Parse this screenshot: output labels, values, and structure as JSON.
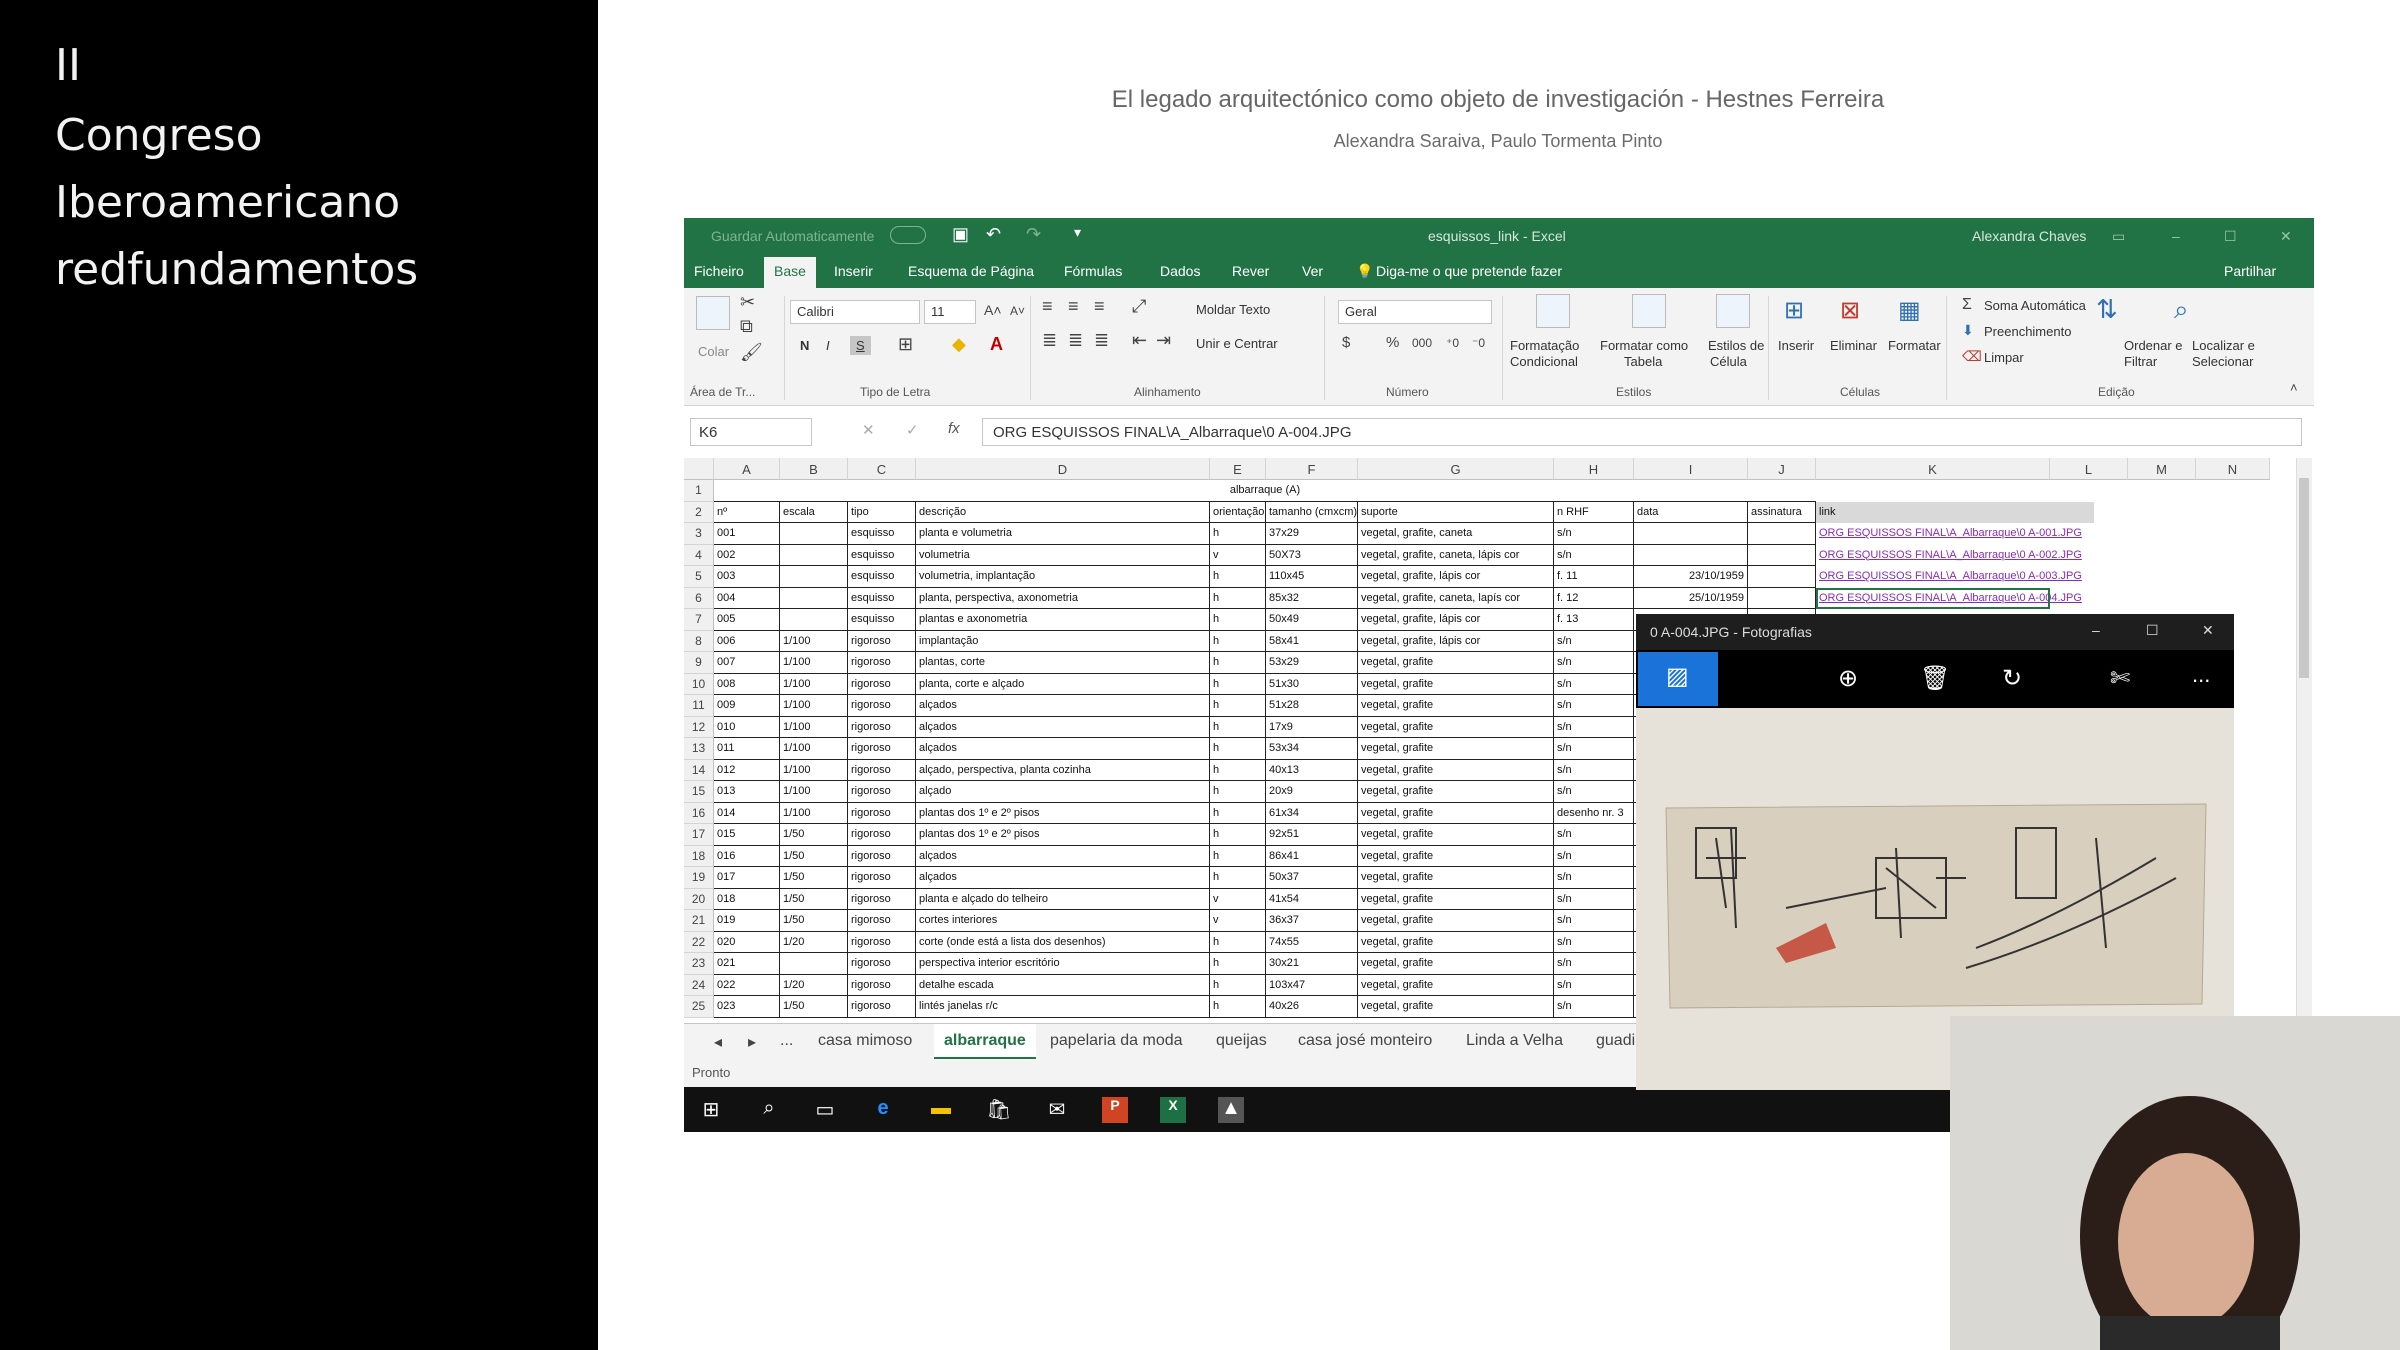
{
  "side": {
    "lines": [
      "II",
      "Congreso",
      "Iberoamericano",
      "redfundamentos"
    ]
  },
  "slide": {
    "title": "El legado arquitectónico como objeto de investigación - Hestnes Ferreira",
    "subtitle": "Alexandra Saraiva, Paulo Tormenta Pinto"
  },
  "excel": {
    "autosave_label": "Guardar Automaticamente",
    "window_title": "esquissos_link - Excel",
    "user": "Alexandra Chaves",
    "menu": [
      "Ficheiro",
      "Base",
      "Inserir",
      "Esquema de Página",
      "Fórmulas",
      "Dados",
      "Rever",
      "Ver"
    ],
    "active_menu": "Base",
    "tell_me": "Diga-me o que pretende fazer",
    "share": "Partilhar",
    "ribbon": {
      "paste": "Colar",
      "font_name": "Calibri",
      "font_size": "11",
      "bold": "N",
      "italic": "I",
      "underline": "S",
      "wrap_text": "Moldar Texto",
      "merge_center": "Unir e Centrar",
      "number_format": "Geral",
      "cond_format": [
        "Formatação",
        "Condicional"
      ],
      "format_table": [
        "Formatar como",
        "Tabela"
      ],
      "cell_styles": [
        "Estilos de",
        "Célula"
      ],
      "insert": "Inserir",
      "delete": "Eliminar",
      "format": "Formatar",
      "autosum": "Soma Automática",
      "fill": "Preenchimento",
      "clear": "Limpar",
      "sort_filter": [
        "Ordenar e",
        "Filtrar"
      ],
      "find_select": [
        "Localizar e",
        "Selecionar"
      ],
      "groups": [
        "Área de Tr...",
        "Tipo de Letra",
        "Alinhamento",
        "Número",
        "Estilos",
        "Células",
        "Edição"
      ]
    },
    "name_box": "K6",
    "formula": "ORG ESQUISSOS FINAL\\A_Albarraque\\0 A-004.JPG",
    "columns": [
      "A",
      "B",
      "C",
      "D",
      "E",
      "F",
      "G",
      "H",
      "I",
      "J",
      "K",
      "L",
      "M",
      "N"
    ],
    "sheet_title": "albarraque (A)",
    "headers": [
      "nº",
      "escala",
      "tipo",
      "descrição",
      "orientação",
      "tamanho (cmxcm)",
      "suporte",
      "n RHF",
      "data",
      "assinatura",
      "link"
    ],
    "rows": [
      [
        "001",
        "",
        "esquisso",
        "planta e volumetria",
        "h",
        "37x29",
        "vegetal, grafite, caneta",
        "s/n",
        "",
        "",
        "ORG ESQUISSOS FINAL\\A_Albarraque\\0 A-001.JPG"
      ],
      [
        "002",
        "",
        "esquisso",
        "volumetria",
        "v",
        "50X73",
        "vegetal, grafite, caneta, lápis cor",
        "s/n",
        "",
        "",
        "ORG ESQUISSOS FINAL\\A_Albarraque\\0 A-002.JPG"
      ],
      [
        "003",
        "",
        "esquisso",
        "volumetria, implantação",
        "h",
        "110x45",
        "vegetal, grafite, lápis cor",
        "f. 11",
        "23/10/1959",
        "",
        "ORG ESQUISSOS FINAL\\A_Albarraque\\0 A-003.JPG"
      ],
      [
        "004",
        "",
        "esquisso",
        "planta, perspectiva, axonometria",
        "h",
        "85x32",
        "vegetal, grafite, caneta, lapís cor",
        "f. 12",
        "25/10/1959",
        "",
        "ORG ESQUISSOS FINAL\\A_Albarraque\\0 A-004.JPG"
      ],
      [
        "005",
        "",
        "esquisso",
        "plantas e axonometria",
        "h",
        "50x49",
        "vegetal, grafite, lápis cor",
        "f. 13",
        "",
        "",
        ""
      ],
      [
        "006",
        "1/100",
        "rigoroso",
        "implantação",
        "h",
        "58x41",
        "vegetal, grafite, lápis cor",
        "s/n",
        "",
        "",
        ""
      ],
      [
        "007",
        "1/100",
        "rigoroso",
        "plantas, corte",
        "h",
        "53x29",
        "vegetal, grafite",
        "s/n",
        "",
        "",
        ""
      ],
      [
        "008",
        "1/100",
        "rigoroso",
        "planta, corte e alçado",
        "h",
        "51x30",
        "vegetal, grafite",
        "s/n",
        "",
        "",
        ""
      ],
      [
        "009",
        "1/100",
        "rigoroso",
        "alçados",
        "h",
        "51x28",
        "vegetal, grafite",
        "s/n",
        "",
        "",
        ""
      ],
      [
        "010",
        "1/100",
        "rigoroso",
        "alçados",
        "h",
        "17x9",
        "vegetal, grafite",
        "s/n",
        "",
        "",
        ""
      ],
      [
        "011",
        "1/100",
        "rigoroso",
        "alçados",
        "h",
        "53x34",
        "vegetal, grafite",
        "s/n",
        "",
        "",
        ""
      ],
      [
        "012",
        "1/100",
        "rigoroso",
        "alçado, perspectiva, planta cozinha",
        "h",
        "40x13",
        "vegetal, grafite",
        "s/n",
        "",
        "",
        ""
      ],
      [
        "013",
        "1/100",
        "rigoroso",
        "alçado",
        "h",
        "20x9",
        "vegetal, grafite",
        "s/n",
        "",
        "",
        ""
      ],
      [
        "014",
        "1/100",
        "rigoroso",
        "plantas dos 1º e 2º pisos",
        "h",
        "61x34",
        "vegetal, grafite",
        "desenho nr. 3",
        "",
        "",
        ""
      ],
      [
        "015",
        "1/50",
        "rigoroso",
        "plantas dos 1º e 2º pisos",
        "h",
        "92x51",
        "vegetal, grafite",
        "s/n",
        "",
        "",
        ""
      ],
      [
        "016",
        "1/50",
        "rigoroso",
        "alçados",
        "h",
        "86x41",
        "vegetal, grafite",
        "s/n",
        "",
        "",
        ""
      ],
      [
        "017",
        "1/50",
        "rigoroso",
        "alçados",
        "h",
        "50x37",
        "vegetal, grafite",
        "s/n",
        "",
        "",
        ""
      ],
      [
        "018",
        "1/50",
        "rigoroso",
        "planta e alçado do telheiro",
        "v",
        "41x54",
        "vegetal, grafite",
        "s/n",
        "",
        "",
        ""
      ],
      [
        "019",
        "1/50",
        "rigoroso",
        "cortes interiores",
        "v",
        "36x37",
        "vegetal, grafite",
        "s/n",
        "",
        "",
        ""
      ],
      [
        "020",
        "1/20",
        "rigoroso",
        "corte (onde está a lista dos desenhos)",
        "h",
        "74x55",
        "vegetal, grafite",
        "s/n",
        "",
        "",
        ""
      ],
      [
        "021",
        "",
        "rigoroso",
        "perspectiva interior escritório",
        "h",
        "30x21",
        "vegetal, grafite",
        "s/n",
        "",
        "",
        ""
      ],
      [
        "022",
        "1/20",
        "rigoroso",
        "detalhe escada",
        "h",
        "103x47",
        "vegetal, grafite",
        "s/n",
        "",
        "",
        ""
      ],
      [
        "023",
        "1/50",
        "rigoroso",
        "lintés janelas r/c",
        "h",
        "40x26",
        "vegetal, grafite",
        "s/n",
        "",
        "",
        ""
      ]
    ],
    "sheets": [
      "casa mimoso",
      "albarraque",
      "papelaria da moda",
      "queijas",
      "casa josé monteiro",
      "Linda a Velha",
      "guadi"
    ],
    "active_sheet": "albarraque",
    "status": "Pronto",
    "ellipsis": "..."
  },
  "photos": {
    "title": "0 A-004.JPG - Fotografias",
    "more": "..."
  }
}
